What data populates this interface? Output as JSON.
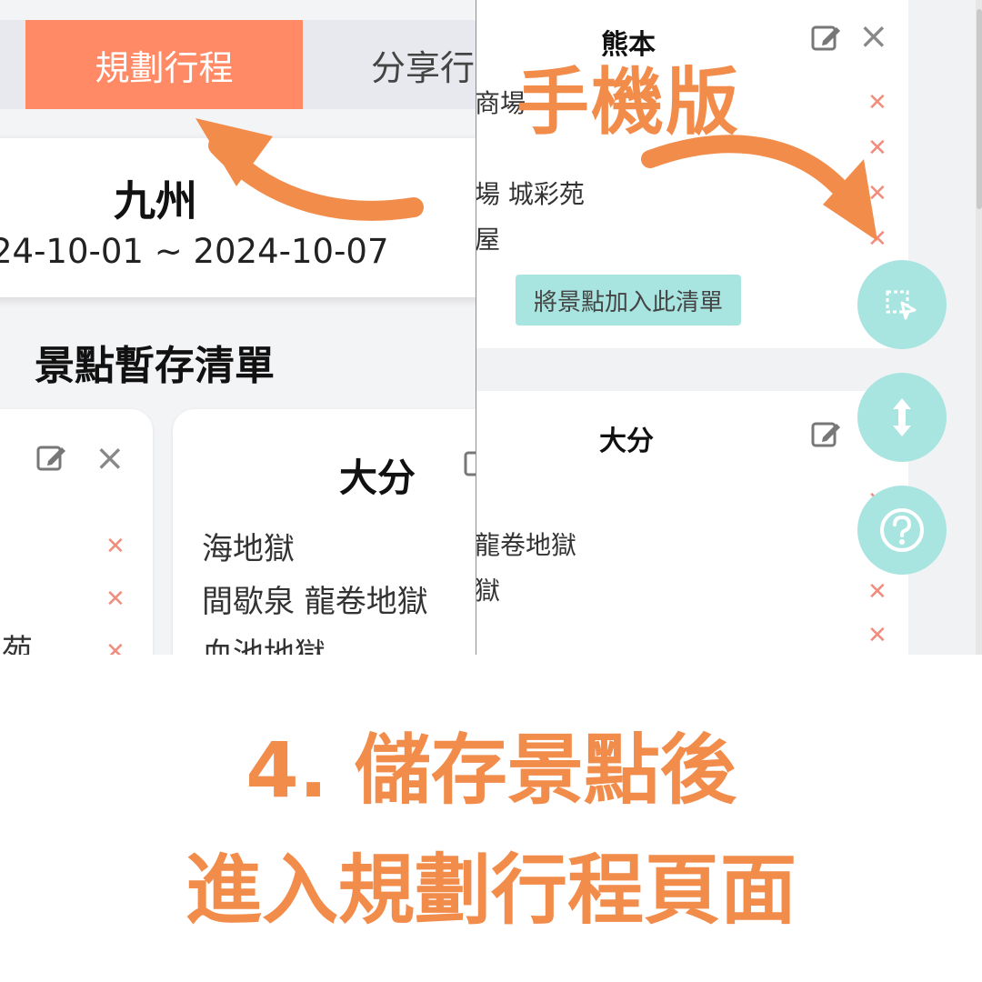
{
  "desktop": {
    "tabs": {
      "active_label": "規劃行程",
      "share_label": "分享行"
    },
    "trip": {
      "title": "九州",
      "dates": "24-10-01 ~ 2024-10-07"
    },
    "pool_heading": "景點暫存清單",
    "card2": {
      "title": "大分",
      "spots": [
        "海地獄",
        "間歇泉 龍卷地獄",
        "血池地獄"
      ]
    },
    "card1_partial_text": "苑"
  },
  "mobile": {
    "card1": {
      "title": "熊本",
      "spots": [
        "商場",
        "場 城彩苑",
        "屋"
      ],
      "add_button": "將景點加入此清單"
    },
    "card2": {
      "title": "大分",
      "spots": [
        "龍卷地獄",
        "獄"
      ]
    }
  },
  "overlay_label": "手機版",
  "caption": {
    "line1": "4. 儲存景點後",
    "line2": "進入規劃行程頁面"
  },
  "icons": [
    "edit-icon",
    "close-icon",
    "remove-icon",
    "select-area-icon",
    "resize-vertical-icon",
    "help-icon"
  ],
  "colors": {
    "accent": "#ff8a65",
    "caption": "#f28c4b",
    "fab": "#a8e4e0",
    "remove": "#f08d7c"
  }
}
